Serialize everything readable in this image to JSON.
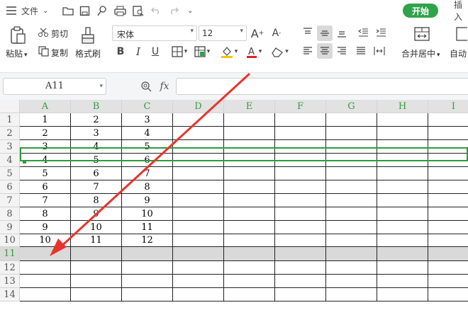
{
  "menubar": {
    "menu_label": "文件",
    "open_label": "开始",
    "insert_label": "插入"
  },
  "ribbon": {
    "paste_label": "粘贴",
    "cut_label": "剪切",
    "copy_label": "复制",
    "format_painter_label": "格式刷",
    "font_name": "宋体",
    "font_size": "12",
    "merge_center_label": "合并居中",
    "auto_wrap_label": "自动"
  },
  "formula_bar": {
    "name_box": "A11",
    "fx_label": "fx",
    "formula_value": ""
  },
  "sheet": {
    "columns": [
      "A",
      "B",
      "C",
      "D",
      "E",
      "F",
      "G",
      "H",
      "I"
    ],
    "rows": [
      "1",
      "2",
      "3",
      "4",
      "5",
      "6",
      "7",
      "8",
      "9",
      "10",
      "11",
      "12",
      "13",
      "14"
    ],
    "cells": [
      [
        "1",
        "2",
        "3"
      ],
      [
        "2",
        "3",
        "4"
      ],
      [
        "3",
        "4",
        "5"
      ],
      [
        "4",
        "5",
        "6"
      ],
      [
        "5",
        "6",
        "7"
      ],
      [
        "6",
        "7",
        "8"
      ],
      [
        "7",
        "8",
        "9"
      ],
      [
        "8",
        "9",
        "10"
      ],
      [
        "9",
        "10",
        "11"
      ],
      [
        "10",
        "11",
        "12"
      ]
    ],
    "selected_row": "11",
    "selection_color": "#2e9a3e",
    "accent_color": "#2fa34a",
    "annotation_arrow_color": "#e8342a"
  }
}
